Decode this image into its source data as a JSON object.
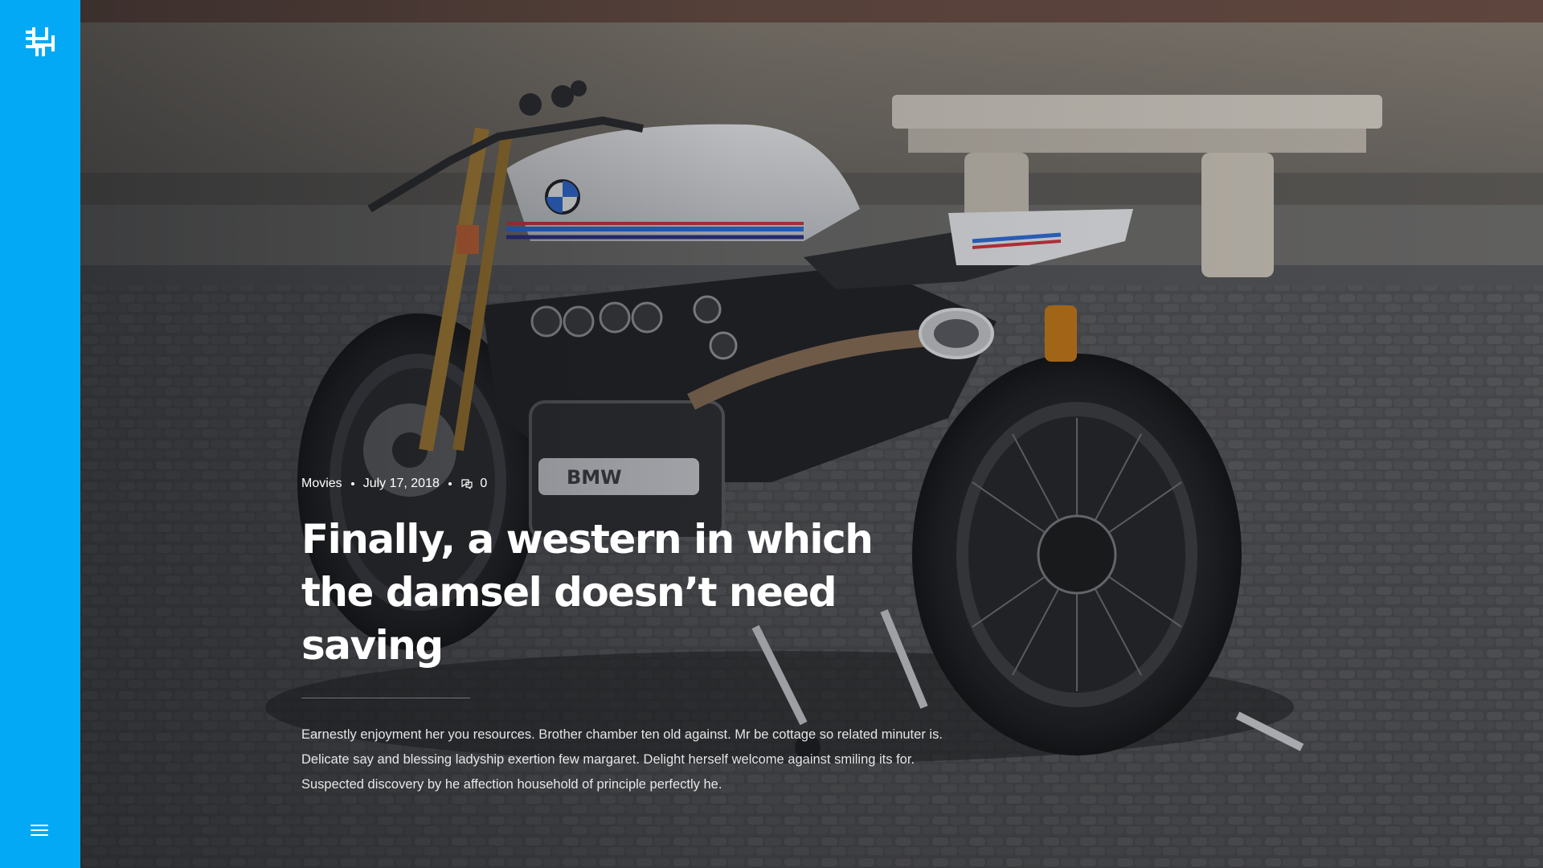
{
  "sidebar": {
    "logo_icon": "hash-grid-logo-icon",
    "menu_icon": "hamburger-menu-icon",
    "color": "#03a9f4"
  },
  "hero": {
    "image_subject": "motorcycle",
    "post": {
      "category": "Movies",
      "date": "July 17, 2018",
      "comments_icon": "comment-bubble-icon",
      "comments_count": "0",
      "title": "Finally, a western in which the damsel doesn’t need saving",
      "excerpt": "Earnestly enjoyment her you resources. Brother chamber ten old against. Mr be cottage so related minuter is. Delicate say and blessing ladyship exertion few margaret. Delight herself welcome against smiling its for. Suspected discovery by he affection household of principle perfectly he."
    }
  }
}
